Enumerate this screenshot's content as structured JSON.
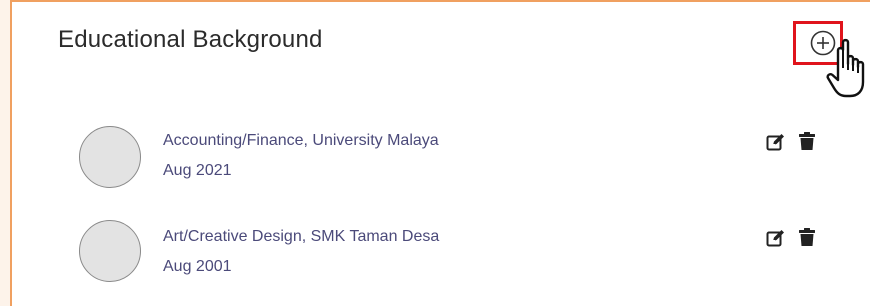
{
  "section": {
    "title": "Educational Background",
    "add_icon": "plus-circle-icon"
  },
  "entries": [
    {
      "title": "Accounting/Finance, University Malaya",
      "date": "Aug 2021",
      "edit_icon": "edit-icon",
      "delete_icon": "trash-icon"
    },
    {
      "title": "Art/Creative Design, SMK Taman Desa",
      "date": "Aug 2001",
      "edit_icon": "edit-icon",
      "delete_icon": "trash-icon"
    }
  ],
  "colors": {
    "accent_border": "#f0a060",
    "highlight_box": "#e0141c",
    "entry_text": "#4b4a7a",
    "title_text": "#2b2b2b",
    "avatar_fill": "#e3e3e3"
  }
}
